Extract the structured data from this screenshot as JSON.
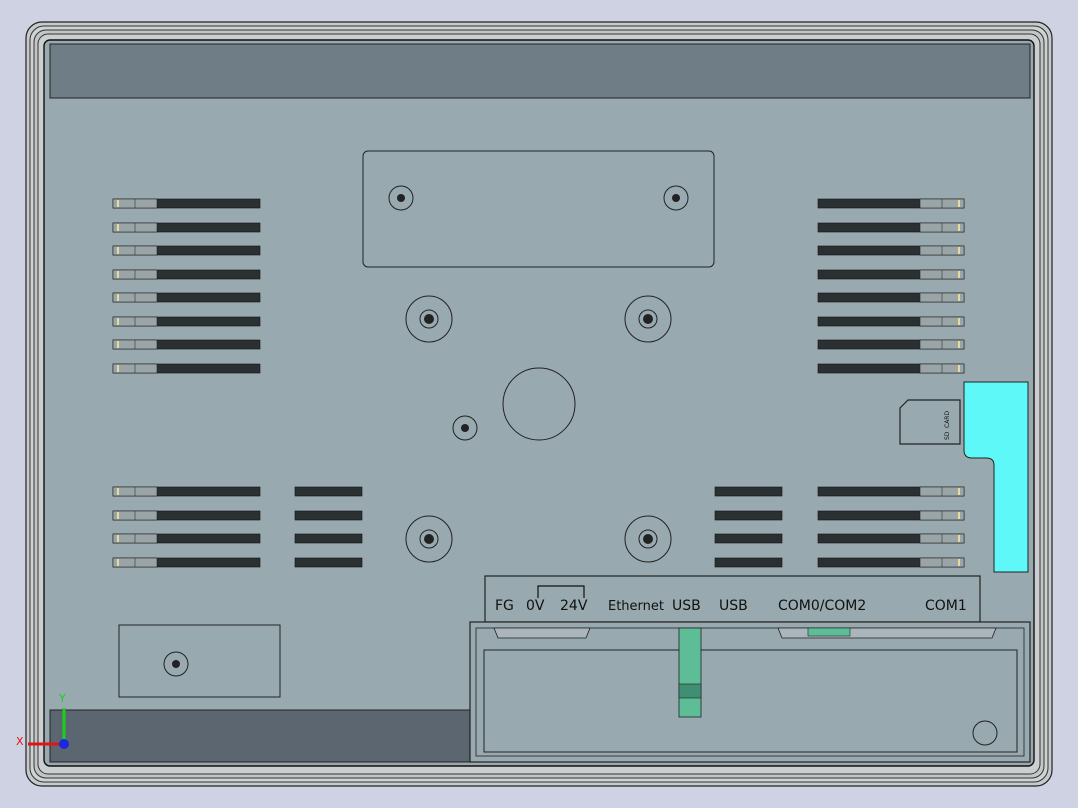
{
  "colors": {
    "background": "#cfd2e3",
    "bezel": "#c4c8c8",
    "panel": "#98a9b0",
    "top_strip": "#6f7d87",
    "bottom_strip": "#5b6670",
    "vent_dark": "#2b3133",
    "sd_slot_cyan": "#5ef8f8",
    "connector_green": "#5dbd97"
  },
  "port_labels": {
    "fg": "FG",
    "zero_v": "0V",
    "v24": "24V",
    "ethernet": "Ethernet",
    "usb1": "USB",
    "usb2": "USB",
    "com0_com2": "COM0/COM2",
    "com1": "COM1"
  },
  "sd_card": {
    "sd": "SD",
    "card": "CARD"
  },
  "axis_triad": {
    "x": "X",
    "y": "Y"
  }
}
